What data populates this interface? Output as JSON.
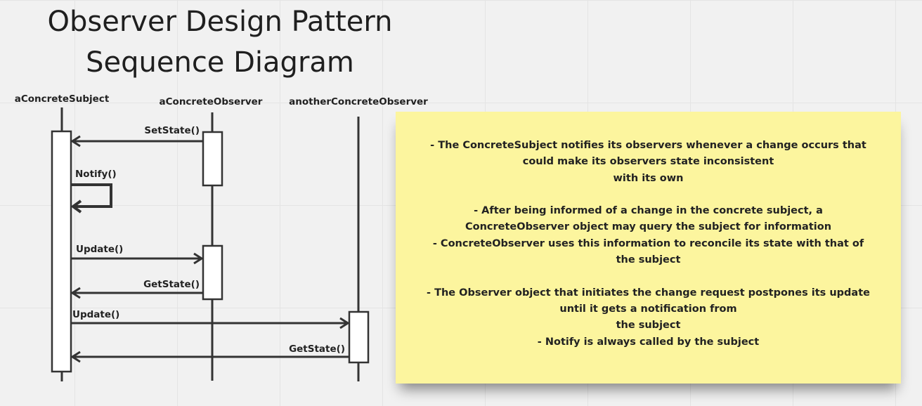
{
  "title": {
    "line1": "Observer Design Pattern",
    "line2": "Sequence Diagram"
  },
  "participants": [
    {
      "name": "aConcreteSubject"
    },
    {
      "name": "aConcreteObserver"
    },
    {
      "name": "anotherConcreteObserver"
    }
  ],
  "messages": [
    {
      "label": "SetState()",
      "from": "aConcreteObserver",
      "to": "aConcreteSubject"
    },
    {
      "label": "Notify()",
      "from": "aConcreteSubject",
      "to": "aConcreteSubject"
    },
    {
      "label": "Update()",
      "from": "aConcreteSubject",
      "to": "aConcreteObserver"
    },
    {
      "label": "GetState()",
      "from": "aConcreteObserver",
      "to": "aConcreteSubject"
    },
    {
      "label": "Update()",
      "from": "aConcreteSubject",
      "to": "anotherConcreteObserver"
    },
    {
      "label": "GetState()",
      "from": "anotherConcreteObserver",
      "to": "aConcreteSubject"
    }
  ],
  "note": {
    "lines": [
      "- The ConcreteSubject notifies its observers whenever a change occurs that",
      "could make its observers state inconsistent",
      "with its own",
      "",
      "- After being informed of a change in the concrete subject, a",
      "ConcreteObserver object may query the subject for information",
      "- ConcreteObserver uses this information to reconcile its state with that of",
      "the subject",
      "",
      "- The Observer object that initiates the change request postpones its update",
      "until it gets a notification from",
      "the subject",
      "- Notify is always called by the subject"
    ],
    "background_color": "#fcf59e"
  },
  "colors": {
    "line": "#333333",
    "background": "#f1f1f1"
  }
}
